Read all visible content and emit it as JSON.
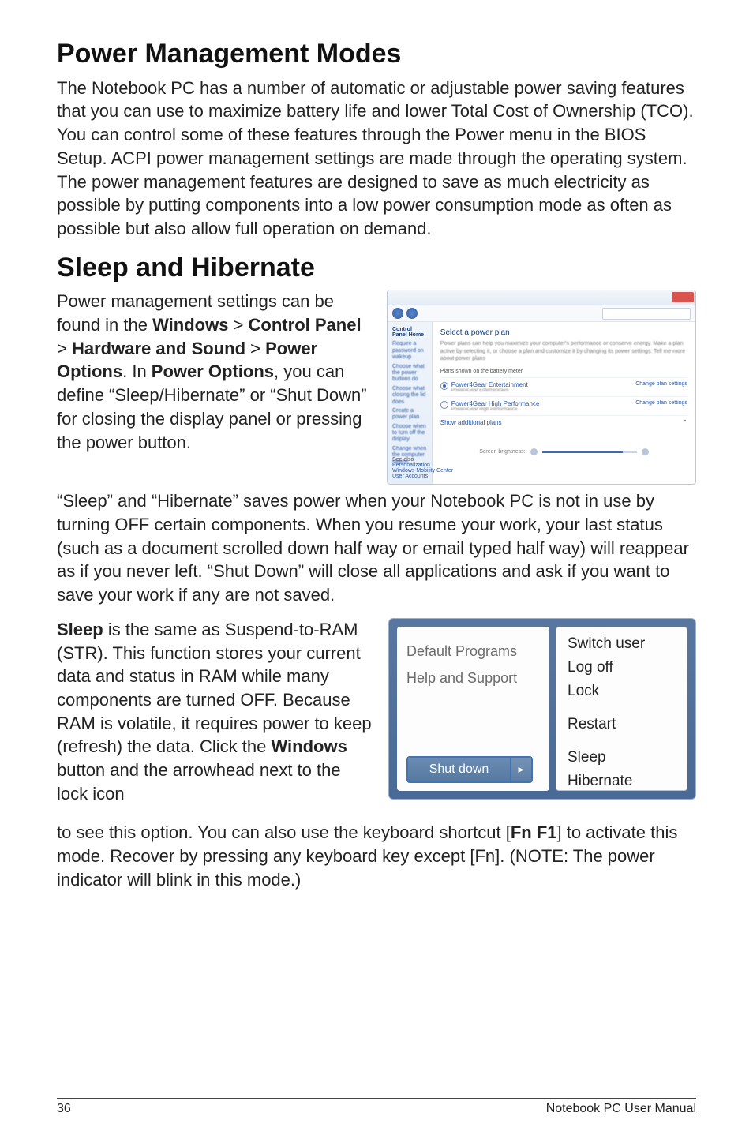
{
  "section1": {
    "title": "Power Management Modes",
    "body": "The Notebook PC has a number of automatic or adjustable power saving features that you can use to maximize battery life and lower Total Cost of Ownership (TCO). You can control some of these features through the Power menu in the BIOS Setup. ACPI power management settings are made through the operating system. The power management features are designed to save as much electricity as possible by putting components into a low power consumption mode as often as possible but also allow full operation on demand."
  },
  "section2": {
    "title": "Sleep and Hibernate",
    "para1_pre": "Power management settings can be found in the ",
    "para1_b1": "Windows",
    "para1_gt1": " > ",
    "para1_b2": "Control Panel",
    "para1_gt2": " > ",
    "para1_b3": "Hardware and Sound",
    "para1_gt3": " > ",
    "para1_b4": "Power Options",
    "para1_mid": ". In ",
    "para1_b5": "Power Options",
    "para1_post": ", you can define “Sleep/Hibernate” or “Shut Down” for closing the display panel or pressing the power button.",
    "para2": "“Sleep” and “Hibernate” saves power when your Notebook PC is not in use by turning OFF certain components. When you resume your work, your last status (such as a document scrolled down half way or email typed half way) will reappear as if you never left. “Shut Down” will close all applications and ask if you want to save your work if any are not saved.",
    "para3_b1": "Sleep",
    "para3_a": " is the same as Suspend-to-RAM (STR). This function stores your current data and status in RAM while many components are turned OFF. Because RAM is volatile, it requires power to keep (refresh) the data. Click the ",
    "para3_b2": "Windows",
    "para3_b": " button and the arrowhead next to the lock icon",
    "para4_a": "to see this option. You can also use the keyboard shortcut [",
    "para4_b1": "Fn F1",
    "para4_b": "] to activate this mode. Recover by pressing any keyboard key except [Fn]. (NOTE: The power indicator will blink in this mode.)"
  },
  "powerOptions": {
    "sidebar": {
      "header": "Control Panel Home",
      "links": [
        "Require a password on wakeup",
        "Choose what the power buttons do",
        "Choose what closing the lid does",
        "Create a power plan",
        "Choose when to turn off the display",
        "Change when the computer sleeps"
      ],
      "seeAlsoHeader": "See also",
      "seeAlso": [
        "Personalization",
        "Windows Mobility Center",
        "User Accounts"
      ]
    },
    "main": {
      "title": "Select a power plan",
      "desc": "Power plans can help you maximize your computer's performance or conserve energy. Make a plan active by selecting it, or choose a plan and customize it by changing its power settings. Tell me more about power plans",
      "plansHeader": "Plans shown on the battery meter",
      "plans": [
        {
          "name": "Power4Gear Entertainment",
          "sub": "Power4Gear Entertainment",
          "change": "Change plan settings",
          "selected": true
        },
        {
          "name": "Power4Gear High Performance",
          "sub": "Power4Gear High Performance",
          "change": "Change plan settings",
          "selected": false
        }
      ],
      "hideLink": "Show additional plans",
      "brightnessLabel": "Screen brightness:"
    }
  },
  "startMenu": {
    "left": {
      "items": [
        "Default Programs",
        "Help and Support"
      ],
      "shutdown": "Shut down"
    },
    "right": {
      "group1": [
        "Switch user",
        "Log off",
        "Lock"
      ],
      "group2": [
        "Restart"
      ],
      "group3": [
        "Sleep",
        "Hibernate"
      ]
    }
  },
  "footer": {
    "page": "36",
    "label": "Notebook PC User Manual"
  }
}
